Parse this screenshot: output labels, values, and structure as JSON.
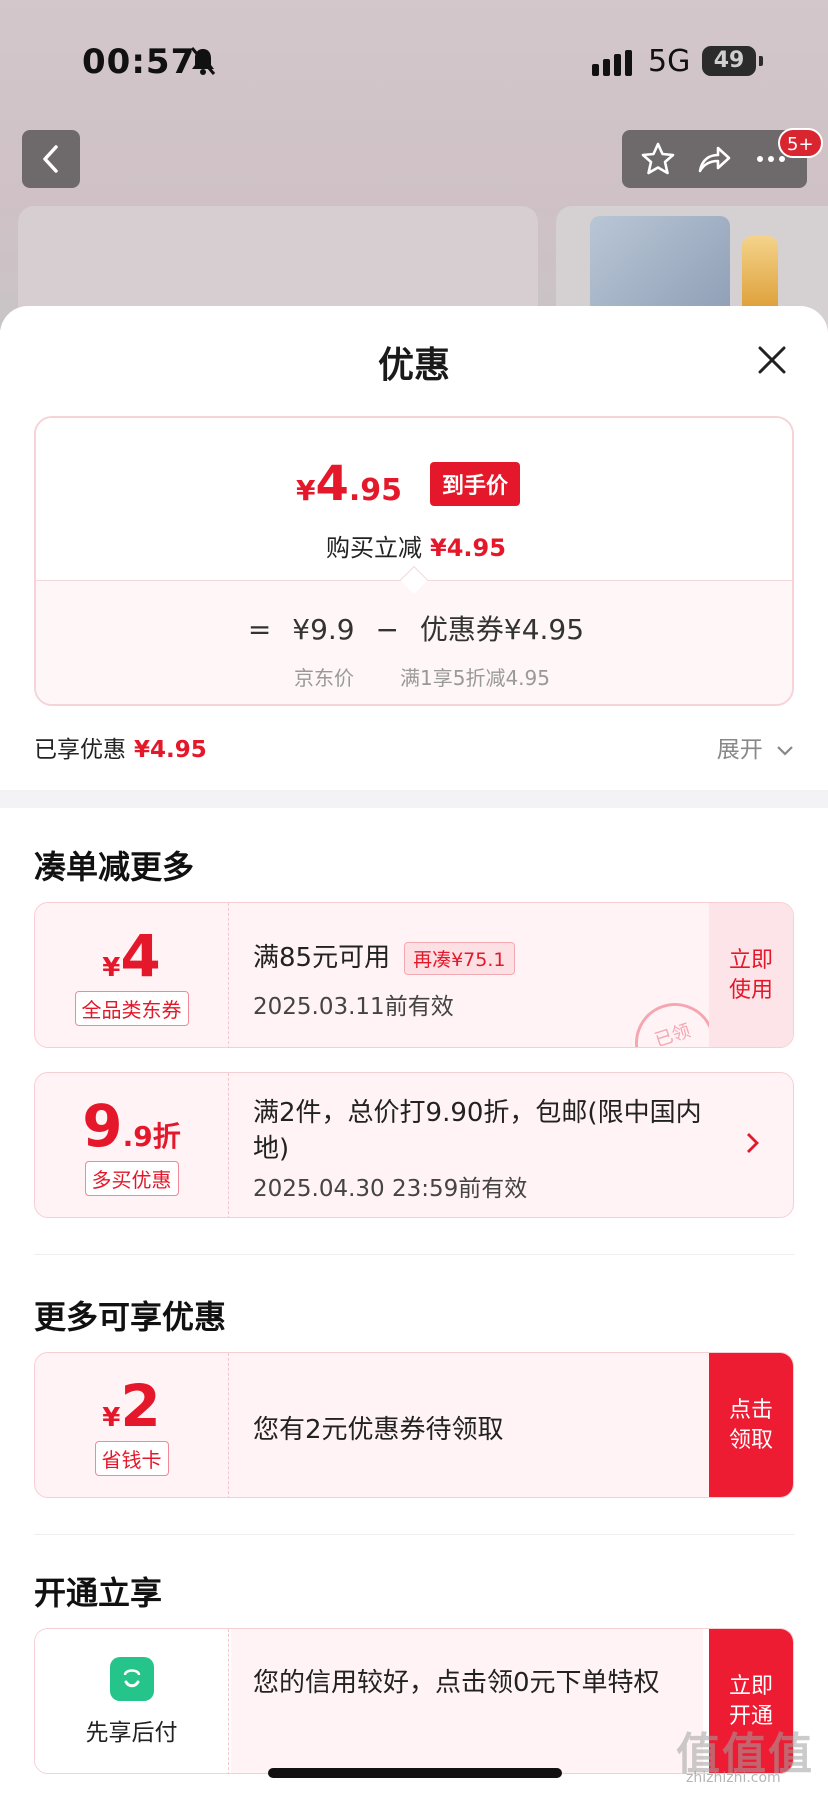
{
  "status": {
    "time": "00:57",
    "network": "5G",
    "battery": "49"
  },
  "header": {
    "badge": "5+"
  },
  "sheet": {
    "title": "优惠",
    "price": {
      "symbol": "¥",
      "int": "4",
      "dec": ".95",
      "tag": "到手价",
      "reduce_label": "购买立减",
      "reduce_value": "¥4.95",
      "formula": {
        "eq": "=",
        "jd_price": "¥9.9",
        "minus": "−",
        "coupon": "优惠券¥4.95",
        "jd_price_label": "京东价",
        "coupon_label": "满1享5折减4.95"
      }
    },
    "enjoyed": {
      "label": "已享优惠",
      "value": "¥4.95",
      "expand": "展开"
    },
    "section_more": "凑单减更多",
    "coupon1": {
      "sym": "¥",
      "num": "4",
      "tag": "全品类东券",
      "main": "满85元可用",
      "extra": "再凑¥75.1",
      "date": "2025.03.11前有效",
      "action": "立即使用",
      "stamp": "已领"
    },
    "coupon2": {
      "num": "9",
      "suf": ".9折",
      "tag": "多买优惠",
      "main": "满2件，总价打9.90折，包邮(限中国内地)",
      "date": "2025.04.30 23:59前有效"
    },
    "section_extra": "更多可享优惠",
    "coupon3": {
      "sym": "¥",
      "num": "2",
      "tag": "省钱卡",
      "main": "您有2元优惠券待领取",
      "action": "点击领取"
    },
    "section_open": "开通立享",
    "coupon4": {
      "label": "先享后付",
      "main": "您的信用较好，点击领0元下单特权",
      "action": "立即开通"
    }
  },
  "watermark": {
    "text": "值值值",
    "url": "zhizhizhi.com"
  },
  "colors": {
    "accent": "#e4182a",
    "accent_bg": "#fff3f5",
    "app_green": "#24c48a"
  }
}
